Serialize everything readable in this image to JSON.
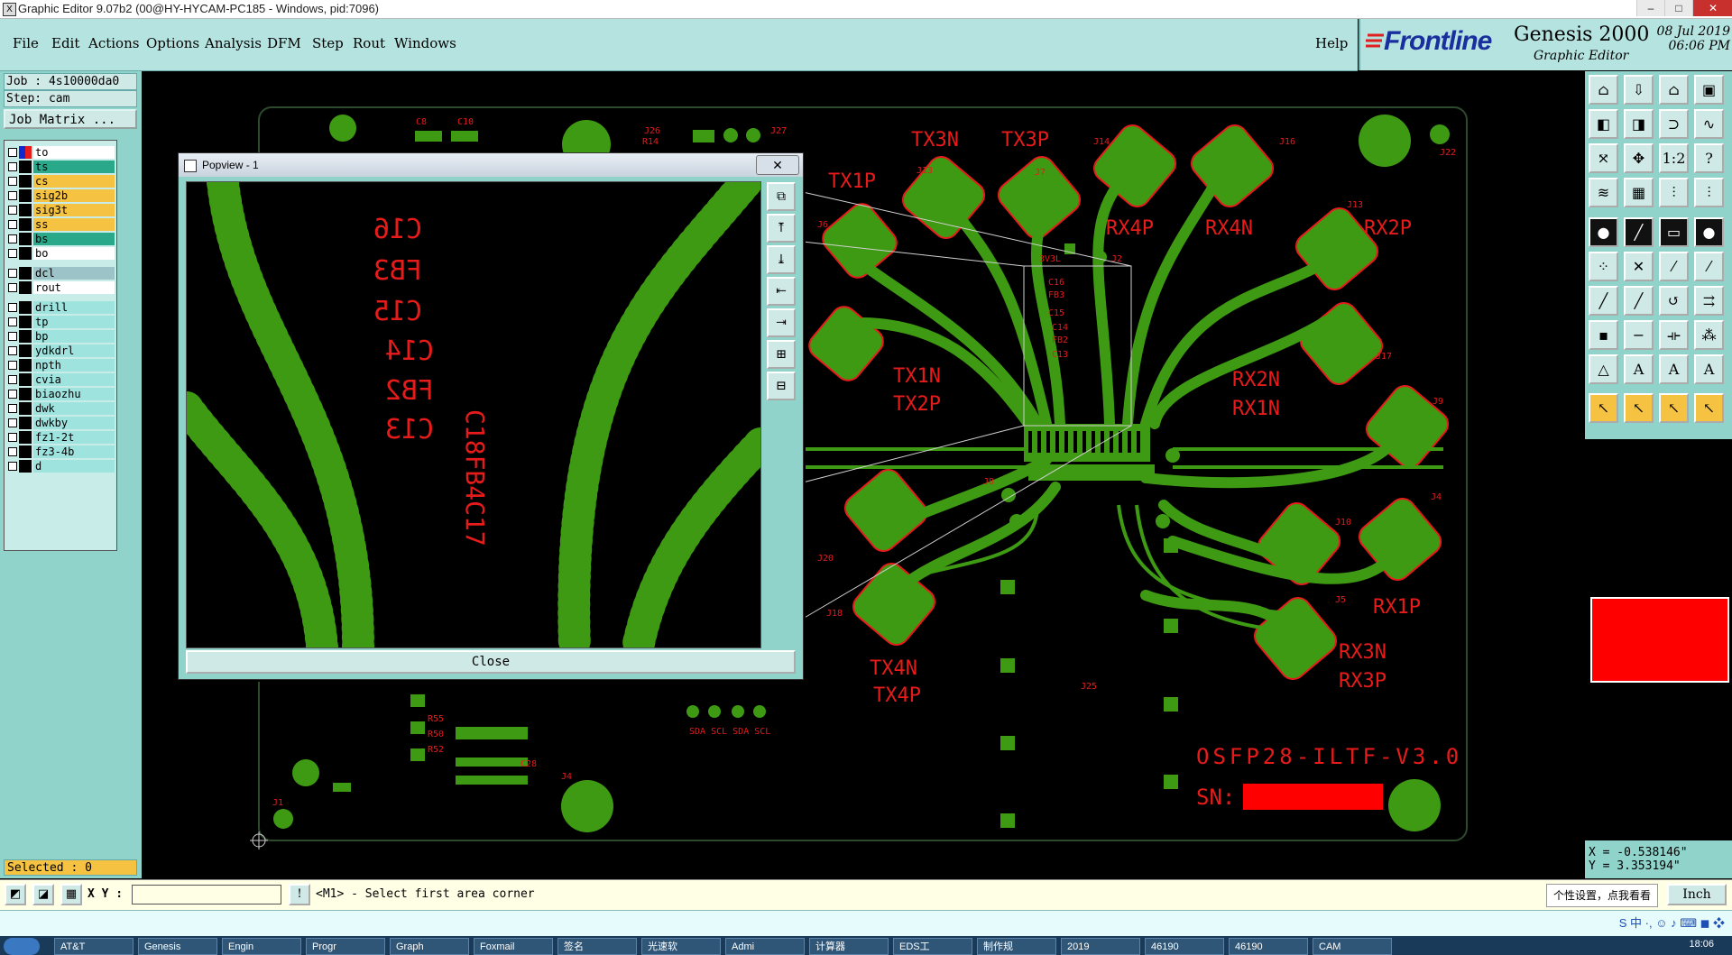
{
  "window": {
    "title": "Graphic Editor 9.07b2 (00@HY-HYCAM-PC185 - Windows, pid:7096)",
    "min": "–",
    "max": "□",
    "close": "✕"
  },
  "menu": {
    "file": "File",
    "edit": "Edit",
    "actions": "Actions",
    "options": "Options",
    "analysis": "Analysis",
    "dfm": "DFM",
    "step": "Step",
    "rout": "Rout",
    "windows": "Windows",
    "help": "Help"
  },
  "brand": {
    "logo": "Frontline",
    "product": "Genesis 2000",
    "subtitle": "Graphic Editor",
    "date": "08 Jul 2019",
    "time": "06:06 PM"
  },
  "job": {
    "job_line": "Job : 4s10000da0",
    "step_line": "Step: cam",
    "matrix_button": "Job Matrix ..."
  },
  "layers": [
    {
      "name": "to",
      "color": "#ffffff"
    },
    {
      "name": "ts",
      "color": "#2aa88a"
    },
    {
      "name": "cs",
      "color": "#f5c242"
    },
    {
      "name": "sig2b",
      "color": "#f5c242"
    },
    {
      "name": "sig3t",
      "color": "#f5c242"
    },
    {
      "name": "ss",
      "color": "#f5c242"
    },
    {
      "name": "bs",
      "color": "#2aa88a"
    },
    {
      "name": "bo",
      "color": "#ffffff"
    },
    {
      "name": "dcl",
      "color": "#9cc4c8"
    },
    {
      "name": "rout",
      "color": "#ffffff"
    },
    {
      "name": "drill",
      "color": "#9fe3df"
    },
    {
      "name": "tp",
      "color": "#9fe3df"
    },
    {
      "name": "bp",
      "color": "#9fe3df"
    },
    {
      "name": "ydkdrl",
      "color": "#9fe3df"
    },
    {
      "name": "npth",
      "color": "#9fe3df"
    },
    {
      "name": "cvia",
      "color": "#9fe3df"
    },
    {
      "name": "biaozhu",
      "color": "#9fe3df"
    },
    {
      "name": "dwk",
      "color": "#9fe3df"
    },
    {
      "name": "dwkby",
      "color": "#9fe3df"
    },
    {
      "name": "fz1-2t",
      "color": "#9fe3df"
    },
    {
      "name": "fz3-4b",
      "color": "#9fe3df"
    },
    {
      "name": "d",
      "color": "#9fe3df"
    }
  ],
  "selected": "Selected : 0",
  "popview": {
    "title": "Popview - 1",
    "close_label": "Close"
  },
  "board": {
    "title_text": "OSFP28-ILTF-V3.0",
    "sn_label": "SN:",
    "diff_labels": [
      "TX3N",
      "TX3P",
      "TX1P",
      "RX4P",
      "RX4N",
      "RX2P",
      "TX1N",
      "TX2P",
      "RX2N",
      "RX1N",
      "RX1P",
      "RX3N",
      "RX3P",
      "TX4N",
      "TX4P"
    ],
    "small_labels": [
      "C8",
      "C10",
      "J26",
      "R14",
      "J27",
      "J6",
      "J22",
      "J14",
      "J16",
      "J13",
      "J7",
      "J13",
      "J17",
      "J9",
      "J10",
      "J4",
      "J5",
      "J8",
      "J20",
      "J18",
      "J25",
      "J1",
      "J4",
      "3V3L",
      "J2",
      "R55",
      "R50",
      "R52",
      "C28",
      "SDA SCL SDA SCL",
      "C16",
      "FB3",
      "C15",
      "C14",
      "FB2",
      "C13"
    ]
  },
  "popview_labels": {
    "c16": "C16",
    "fb3": "FB3",
    "c15": "C15",
    "c14": "C14",
    "fb2": "FB2",
    "c13": "C13",
    "vertical": "C18FB4C17"
  },
  "status": {
    "xy_label": "X Y :",
    "prompt": "<M1> - Select first area corner",
    "tooltip": "个性设置，点我看看",
    "unit": "Inch"
  },
  "coords": {
    "x": "X = -0.538146\"",
    "y": "Y = 3.353194\""
  },
  "taskbar": {
    "items": [
      "AT&T",
      "Genesis",
      "Engin",
      "Progr",
      "Graph",
      "Foxmail",
      "签名",
      "光速软",
      "Admi",
      "计算器",
      "EDS工",
      "制作规",
      "2019",
      "46190",
      "46190",
      "CAM"
    ],
    "clock": "18:06"
  },
  "colors": {
    "copper": "#3e9a12",
    "outline": "#e81b1b",
    "panel": "#8fd3cb",
    "menu": "#b5e3e0"
  }
}
